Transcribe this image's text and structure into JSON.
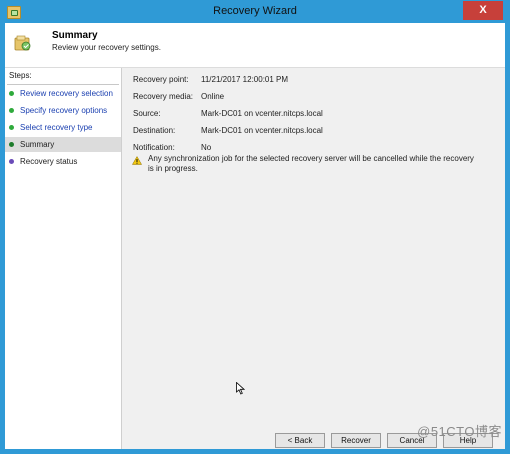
{
  "window": {
    "title": "Recovery Wizard",
    "close_symbol": "X"
  },
  "header": {
    "title": "Summary",
    "subtitle": "Review your recovery settings."
  },
  "steps": {
    "heading": "Steps:",
    "items": [
      {
        "label": "Review recovery selection",
        "state": "done"
      },
      {
        "label": "Specify recovery options",
        "state": "done"
      },
      {
        "label": "Select recovery type",
        "state": "done"
      },
      {
        "label": "Summary",
        "state": "current"
      },
      {
        "label": "Recovery status",
        "state": "pending"
      }
    ]
  },
  "summary": {
    "fields": [
      {
        "label": "Recovery point:",
        "value": "11/21/2017 12:00:01 PM"
      },
      {
        "label": "Recovery media:",
        "value": "Online"
      },
      {
        "label": "Source:",
        "value": "Mark-DC01 on vcenter.nitcps.local"
      },
      {
        "label": "Destination:",
        "value": "Mark-DC01 on vcenter.nitcps.local"
      },
      {
        "label": "Notification:",
        "value": "No"
      }
    ],
    "warning": "Any synchronization job for the selected recovery server will be cancelled while the recovery is in progress."
  },
  "footer": {
    "back_label": "< Back",
    "recover_label": "Recover",
    "cancel_label": "Cancel",
    "help_label": "Help"
  },
  "watermark": "@51CTO博客",
  "colors": {
    "title_bar": "#2f9ad6",
    "close_button": "#c7403a",
    "link_blue": "#1a3fb0",
    "done_dot": "#2faa3c",
    "pending_dot": "#6a4bb8"
  }
}
